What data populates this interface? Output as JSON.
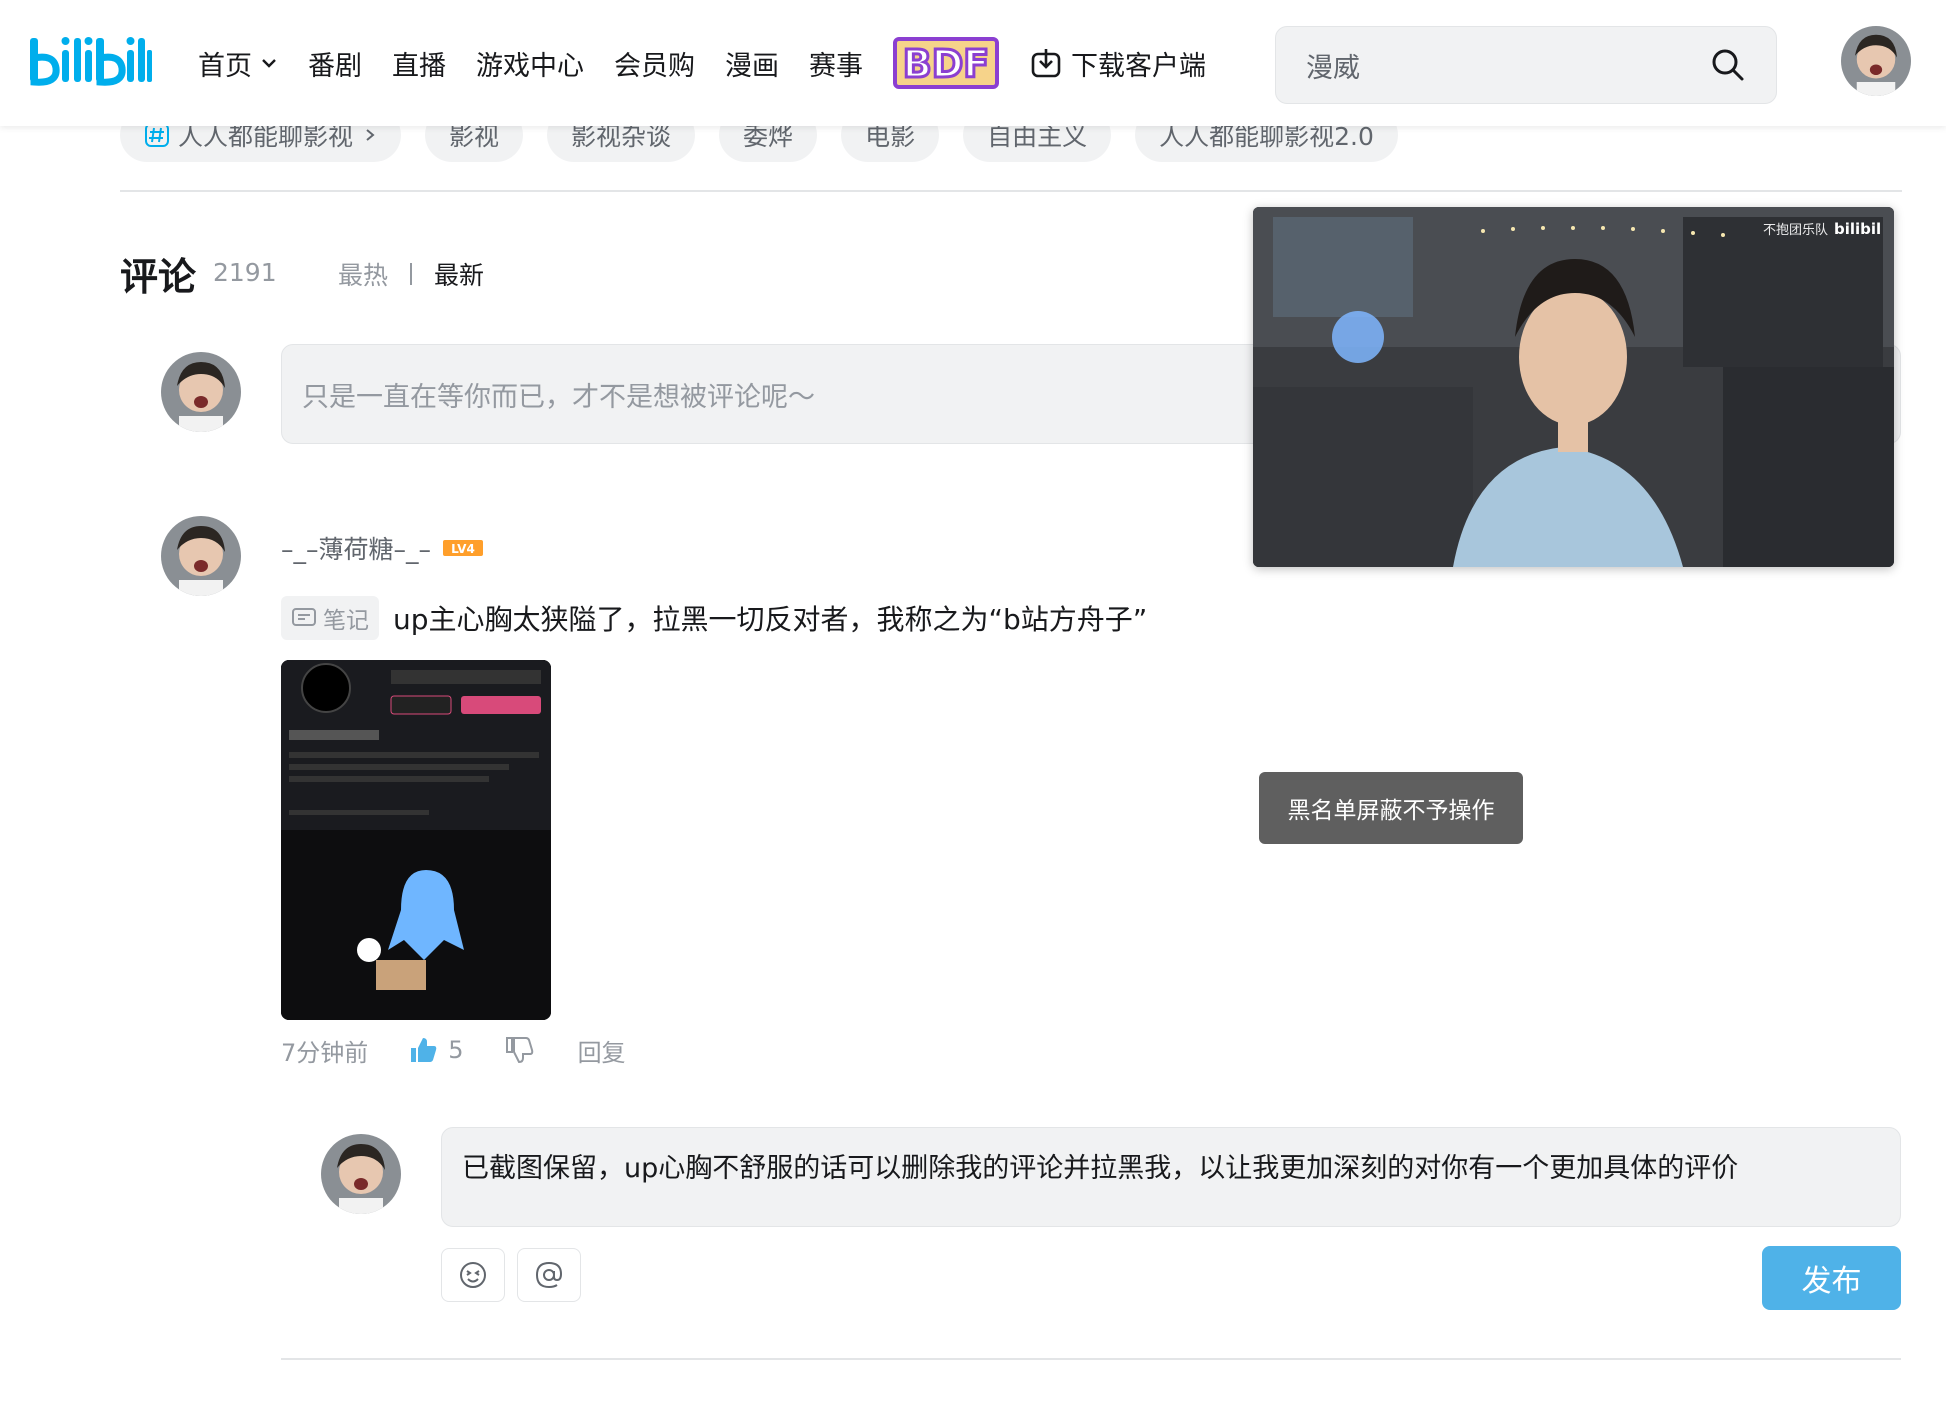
{
  "header": {
    "logo_text": "bilibili",
    "nav": [
      {
        "label": "首页"
      },
      {
        "label": "番剧"
      },
      {
        "label": "直播"
      },
      {
        "label": "游戏中心"
      },
      {
        "label": "会员购"
      },
      {
        "label": "漫画"
      },
      {
        "label": "赛事"
      }
    ],
    "bdf_badge": "BDF",
    "download_label": "下载客户端",
    "search_value": "漫威",
    "icons": {
      "search": "search-icon",
      "download": "download-icon",
      "chevron": "chevron-down-icon"
    }
  },
  "tags": {
    "topic": "人人都能聊影视",
    "items": [
      "影视",
      "影视杂谈",
      "委烨",
      "电影",
      "自由主义",
      "人人都能聊影视2.0"
    ]
  },
  "comments": {
    "title": "评论",
    "count": "2191",
    "sort_hot": "最热",
    "sort_new": "最新",
    "input_placeholder": "只是一直在等你而已，才不是想被评论呢～"
  },
  "mini_player": {
    "watermark_text": "不抱团乐队",
    "watermark_logo": "bilibili"
  },
  "comment": {
    "username": "–_–薄荷糖–_–",
    "level": "LV4",
    "note_tag": "笔记",
    "text": "up主心胸太狭隘了，拉黑一切反对者，我称之为“b站方舟子”",
    "time": "7分钟前",
    "likes": "5",
    "reply_label": "回复"
  },
  "toast": {
    "text": "黑名单屏蔽不予操作"
  },
  "reply_box": {
    "value": "已截图保留，up心胸不舒服的话可以删除我的评论并拉黑我，以让我更加深刻的对你有一个更加具体的评价",
    "publish_label": "发布",
    "icons": {
      "emoji": "emoji-icon",
      "mention": "at-mention-icon"
    }
  },
  "colors": {
    "brand_blue": "#00aeec",
    "publish_blue": "#4fb2e8",
    "level_orange": "#ff9f2b",
    "bdf_purple": "#8b3fd1"
  }
}
